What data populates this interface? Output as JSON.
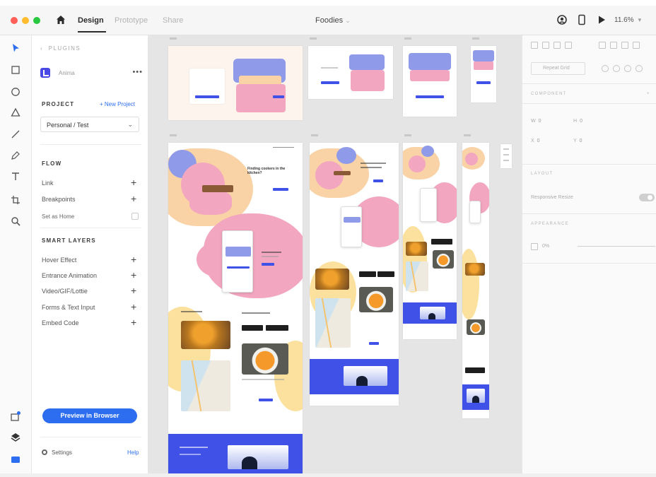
{
  "titlebar": {
    "tabs": [
      {
        "label": "Design",
        "active": true
      },
      {
        "label": "Prototype",
        "active": false
      },
      {
        "label": "Share",
        "active": false
      }
    ],
    "document_title": "Foodies",
    "zoom": "11.6%"
  },
  "plugin_panel": {
    "breadcrumb": "PLUGINS",
    "plugin_name": "Anima",
    "project_heading": "PROJECT",
    "new_project_label": "+ New Project",
    "project_select_value": "Personal / Test",
    "flow_heading": "FLOW",
    "flow_items": [
      {
        "label": "Link",
        "control": "plus"
      },
      {
        "label": "Breakpoints",
        "control": "plus"
      },
      {
        "label": "Set as Home",
        "control": "checkbox"
      }
    ],
    "smart_layers_heading": "SMART LAYERS",
    "smart_layers": [
      {
        "label": "Hover Effect"
      },
      {
        "label": "Entrance Animation"
      },
      {
        "label": "Video/GIF/Lottie"
      },
      {
        "label": "Forms & Text Input"
      },
      {
        "label": "Embed Code"
      }
    ],
    "preview_button": "Preview in Browser",
    "settings_label": "Settings",
    "help_label": "Help"
  },
  "canvas": {
    "hero_headline": "Finding cookers in the kitchen?"
  },
  "properties": {
    "repeat_grid_label": "Repeat Grid",
    "component_heading": "COMPONENT",
    "fields": [
      {
        "name": "W",
        "value": "0"
      },
      {
        "name": "H",
        "value": "0"
      },
      {
        "name": "X",
        "value": "0"
      },
      {
        "name": "Y",
        "value": "0"
      }
    ],
    "layout_heading": "LAYOUT",
    "responsive_resize_label": "Responsive Resize",
    "appearance_heading": "APPEARANCE",
    "opacity_value": "0%"
  },
  "colors": {
    "accent_blue": "#2d6ef0",
    "brand_blue": "#3f51e6",
    "pink": "#f2a6bf",
    "peach": "#f9d2a6",
    "yellow": "#fbe19d"
  },
  "icons": {
    "toolbar": [
      "home-icon",
      "user-icon",
      "device-icon",
      "play-icon"
    ],
    "tools": [
      "select-icon",
      "rectangle-icon",
      "ellipse-icon",
      "triangle-icon",
      "line-icon",
      "pen-icon",
      "text-icon",
      "artboard-icon",
      "zoom-icon"
    ],
    "bottom_tools": [
      "plugins-icon",
      "layers-icon",
      "assets-icon"
    ]
  }
}
